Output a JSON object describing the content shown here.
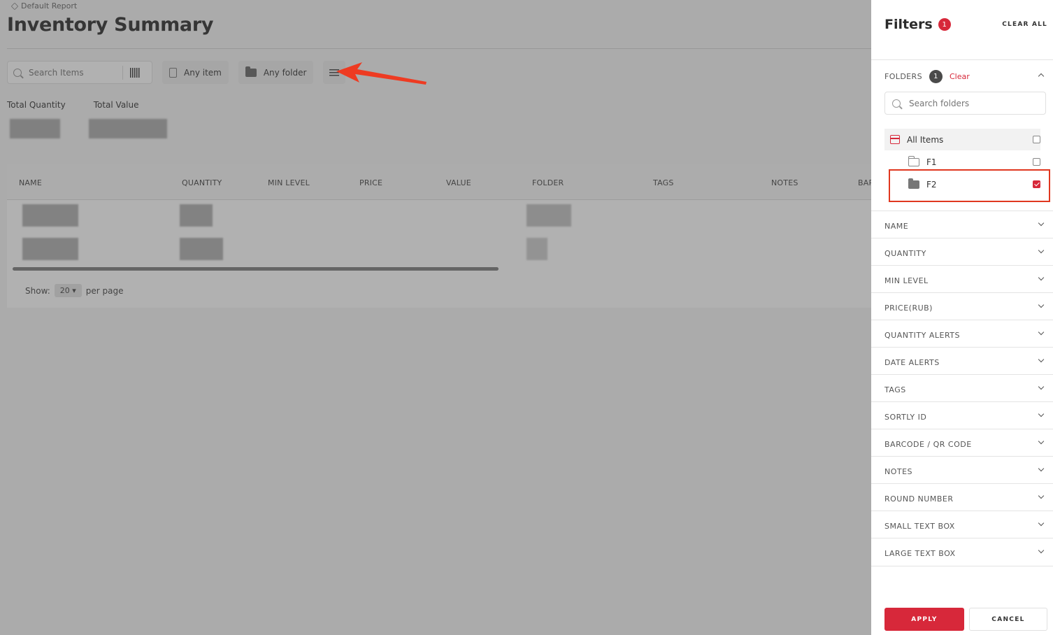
{
  "page": {
    "breadcrumb": "Default Report",
    "title": "Inventory Summary",
    "search_placeholder": "Search Items",
    "any_item_label": "Any item",
    "any_folder_label": "Any folder",
    "total_quantity_label": "Total Quantity",
    "total_value_label": "Total Value",
    "columns": [
      "NAME",
      "QUANTITY",
      "MIN LEVEL",
      "PRICE",
      "VALUE",
      "FOLDER",
      "TAGS",
      "NOTES",
      "BAR"
    ],
    "pager": {
      "show": "Show:",
      "value": "20 ▾",
      "per_page": "per page"
    }
  },
  "panel": {
    "title": "Filters",
    "count": "1",
    "clear_all": "CLEAR ALL",
    "folders": {
      "label": "FOLDERS",
      "count": "1",
      "clear": "Clear",
      "search_placeholder": "Search folders",
      "items": [
        {
          "label": "All Items",
          "checked": false
        },
        {
          "label": "F1",
          "checked": false
        },
        {
          "label": "F2",
          "checked": true
        }
      ]
    },
    "sections": [
      "NAME",
      "QUANTITY",
      "MIN LEVEL",
      "PRICE(RUB)",
      "QUANTITY ALERTS",
      "DATE ALERTS",
      "TAGS",
      "SORTLY ID",
      "BARCODE / QR CODE",
      "NOTES",
      "ROUND NUMBER",
      "SMALL TEXT BOX",
      "LARGE TEXT BOX"
    ],
    "apply": "APPLY",
    "cancel": "CANCEL"
  },
  "colors": {
    "accent": "#d7283a",
    "highlight": "#e0371f",
    "arrow": "#ee3b22"
  }
}
